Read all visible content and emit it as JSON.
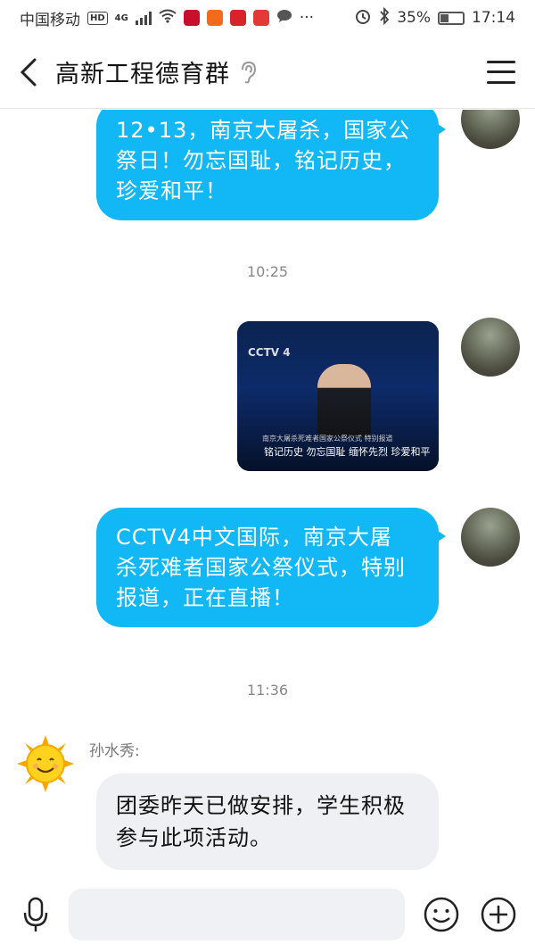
{
  "status_bar": {
    "carrier": "中国移动",
    "hd": "HD",
    "network": "4G",
    "battery": "35%",
    "time": "17:14",
    "dots": "···"
  },
  "header": {
    "title": "高新工程德育群",
    "back_icon": "chevron-left-icon",
    "ear_icon": "ear-icon",
    "menu_icon": "hamburger-menu-icon"
  },
  "messages": [
    {
      "side": "right",
      "type": "text",
      "text_lines": [
        "12•13，南京大屠杀，国家公",
        "祭日！勿忘国耻，铭记历史，",
        "珍爱和平！"
      ]
    },
    {
      "type": "time",
      "text": "10:25"
    },
    {
      "side": "right",
      "type": "image",
      "image": {
        "logo": "CCTV 4",
        "small_caption": "南京大屠杀死难者国家公祭仪式 特别报道",
        "caption": "铭记历史  勿忘国耻  缅怀先烈  珍爱和平"
      }
    },
    {
      "side": "right",
      "type": "text",
      "text_lines": [
        "CCTV4中文国际，南京大屠",
        "杀死难者国家公祭仪式，特别",
        "报道，正在直播！"
      ]
    },
    {
      "type": "time",
      "text": "11:36"
    },
    {
      "side": "left",
      "type": "text",
      "sender": "孙水秀:",
      "text_lines": [
        "团委昨天已做安排，学生积极",
        "参与此项活动。"
      ]
    }
  ],
  "input_bar": {
    "placeholder": "",
    "mic_icon": "microphone-icon",
    "emoji_icon": "smiley-icon",
    "plus_icon": "plus-circle-icon"
  },
  "colors": {
    "bubble_blue": "#12b7f5",
    "bubble_gray": "#eef0f4",
    "timestamp": "#888888"
  }
}
